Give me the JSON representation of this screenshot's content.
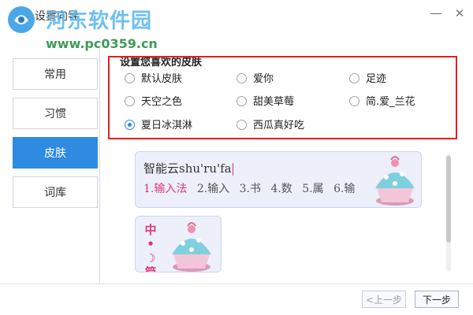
{
  "window": {
    "title": "设置向导",
    "minimize_glyph": "—",
    "close_glyph": "✕"
  },
  "watermark": {
    "site": "河东软件园",
    "url": "www.pc0359.cn"
  },
  "sidebar": {
    "items": [
      {
        "label": "常用",
        "active": false
      },
      {
        "label": "习惯",
        "active": false
      },
      {
        "label": "皮肤",
        "active": true
      },
      {
        "label": "词库",
        "active": false
      }
    ]
  },
  "skins": {
    "title": "设置您喜欢的皮肤",
    "options": [
      {
        "label": "默认皮肤",
        "selected": false
      },
      {
        "label": "爱你",
        "selected": false
      },
      {
        "label": "足迹",
        "selected": false
      },
      {
        "label": "天空之色",
        "selected": false
      },
      {
        "label": "甜美草莓",
        "selected": false
      },
      {
        "label": "简.爱_兰花",
        "selected": false
      },
      {
        "label": "夏日冰淇淋",
        "selected": true
      },
      {
        "label": "西瓜真好吃",
        "selected": false
      }
    ]
  },
  "preview": {
    "pinyin": "智能云shu'ru'fa",
    "candidates": [
      "1.输入法",
      "2.输入",
      "3.书",
      "4.数",
      "5.属",
      "6.输"
    ],
    "vertical_chars": [
      "中",
      "•",
      "☽",
      "简"
    ]
  },
  "footer": {
    "prev_label": "<上一步",
    "next_label": "下一步",
    "prev_enabled": false
  },
  "colors": {
    "accent": "#2f8ae2",
    "highlight": "#e02020",
    "candidate_first": "#e0347a"
  }
}
